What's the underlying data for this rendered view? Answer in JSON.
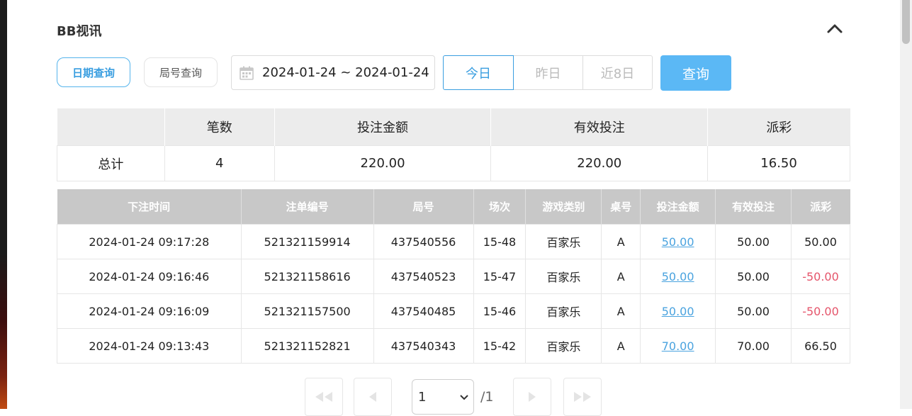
{
  "title": "BB视讯",
  "tabs": {
    "date_query": "日期查询",
    "round_query": "局号查询"
  },
  "date_range": "2024-01-24 ~ 2024-01-24",
  "quick_dates": [
    "今日",
    "昨日",
    "近8日"
  ],
  "query_label": "查询",
  "summary": {
    "headers": [
      "",
      "笔数",
      "投注金额",
      "有效投注",
      "派彩"
    ],
    "row": [
      "总计",
      "4",
      "220.00",
      "220.00",
      "16.50"
    ]
  },
  "records": {
    "headers": [
      "下注时间",
      "注单编号",
      "局号",
      "场次",
      "游戏类别",
      "桌号",
      "投注金额",
      "有效投注",
      "派彩"
    ],
    "rows": [
      [
        "2024-01-24 09:17:28",
        "521321159914",
        "437540556",
        "15-48",
        "百家乐",
        "A",
        "50.00",
        "50.00",
        "50.00"
      ],
      [
        "2024-01-24 09:16:46",
        "521321158616",
        "437540523",
        "15-47",
        "百家乐",
        "A",
        "50.00",
        "50.00",
        "-50.00"
      ],
      [
        "2024-01-24 09:16:09",
        "521321157500",
        "437540485",
        "15-46",
        "百家乐",
        "A",
        "50.00",
        "50.00",
        "-50.00"
      ],
      [
        "2024-01-24 09:13:43",
        "521321152821",
        "437540343",
        "15-42",
        "百家乐",
        "A",
        "70.00",
        "70.00",
        "66.50"
      ]
    ]
  },
  "pagination": {
    "current": "1",
    "total": "/1"
  },
  "colors": {
    "accent": "#3a9ee0",
    "button": "#5bb8f5",
    "negative": "#e5556b",
    "header_bg": "#c8c8c8"
  }
}
